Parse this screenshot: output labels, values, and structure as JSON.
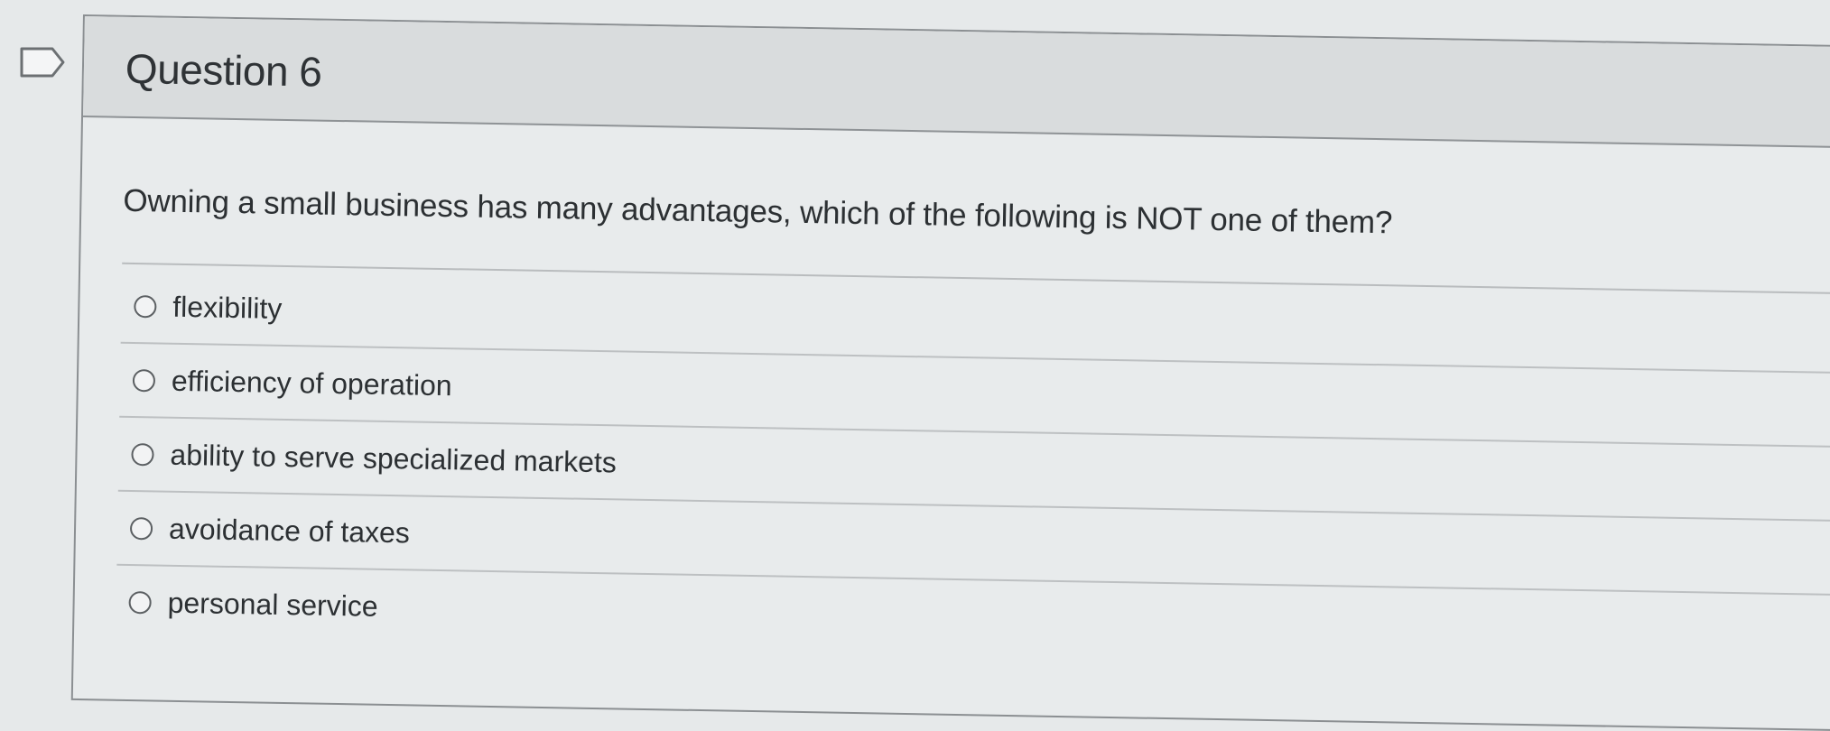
{
  "question": {
    "title": "Question 6",
    "text": "Owning a small business has many advantages, which of the following is NOT one of them?",
    "options": [
      {
        "label": "flexibility",
        "selected": false
      },
      {
        "label": "efficiency of operation",
        "selected": false
      },
      {
        "label": "ability to serve specialized markets",
        "selected": false
      },
      {
        "label": "avoidance of taxes",
        "selected": false
      },
      {
        "label": "personal service",
        "selected": false
      }
    ]
  },
  "icons": {
    "flag": "flag-outline-icon",
    "radio": "radio-unselected-icon"
  },
  "colors": {
    "header_bg": "#d9dcdd",
    "card_bg": "#e8ebec",
    "border": "#8b8f92",
    "text": "#2c3033"
  }
}
